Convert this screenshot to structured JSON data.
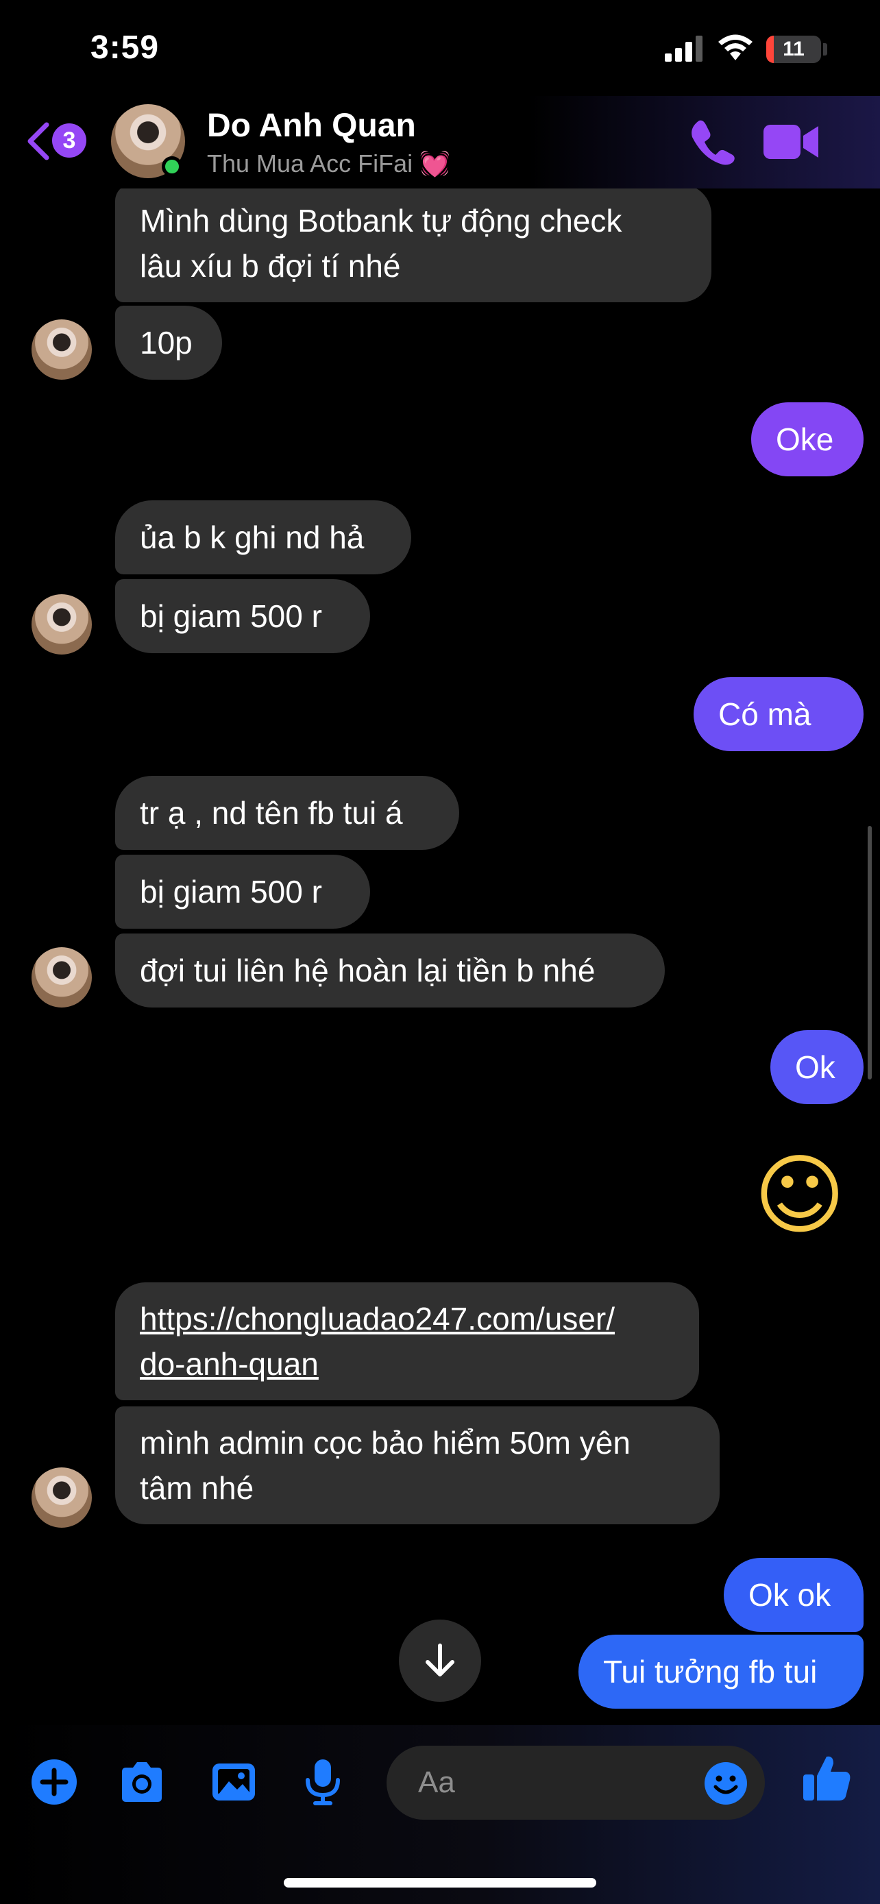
{
  "status_bar": {
    "time": "3:59",
    "battery_level": "11"
  },
  "header": {
    "back_badge": "3",
    "contact_name": "Do Anh Quan",
    "contact_subtitle": "Thu Mua Acc FiFai",
    "subtitle_emoji": "💓"
  },
  "messages": [
    {
      "side": "in",
      "lines": [
        "Mình dùng Botbank tự động check",
        "lâu xíu b đợi tí nhé"
      ]
    },
    {
      "side": "in",
      "lines": [
        "10p"
      ]
    },
    {
      "side": "out",
      "lines": [
        "Oke"
      ]
    },
    {
      "side": "in",
      "lines": [
        "ủa b k ghi nd hả"
      ]
    },
    {
      "side": "in",
      "lines": [
        "bị giam 500 r"
      ]
    },
    {
      "side": "out",
      "lines": [
        "Có mà"
      ]
    },
    {
      "side": "in",
      "lines": [
        "tr ạ , nd tên fb tui á"
      ]
    },
    {
      "side": "in",
      "lines": [
        "bị giam 500 r"
      ]
    },
    {
      "side": "in",
      "lines": [
        "đợi tui liên hệ hoàn lại tiền b nhé"
      ]
    },
    {
      "side": "out",
      "lines": [
        "Ok"
      ]
    },
    {
      "side": "out",
      "emoji": "☺"
    },
    {
      "side": "in",
      "lines": [
        "https://chongluadao247.com/user/",
        "do-anh-quan"
      ],
      "link": true
    },
    {
      "side": "in",
      "lines": [
        "mình admin cọc bảo hiểm 50m yên",
        "tâm nhé"
      ]
    },
    {
      "side": "out",
      "lines": [
        "Ok ok"
      ]
    },
    {
      "side": "out",
      "lines": [
        "Tui tưởng fb tui"
      ]
    }
  ],
  "composer": {
    "placeholder": "Aa"
  },
  "colors": {
    "outgoing_top": "#9547f5",
    "outgoing_bottom": "#2d68f6",
    "incoming": "#303030",
    "accent": "#9547f5",
    "composer_icons": "#1f7cff"
  },
  "icons": {
    "header": [
      "back-chevron-icon",
      "phone-icon",
      "video-camera-icon"
    ],
    "composer": [
      "plus-icon",
      "camera-icon",
      "photo-icon",
      "microphone-icon",
      "smiley-icon",
      "thumbs-up-icon"
    ],
    "chat": [
      "arrow-down-icon"
    ]
  }
}
